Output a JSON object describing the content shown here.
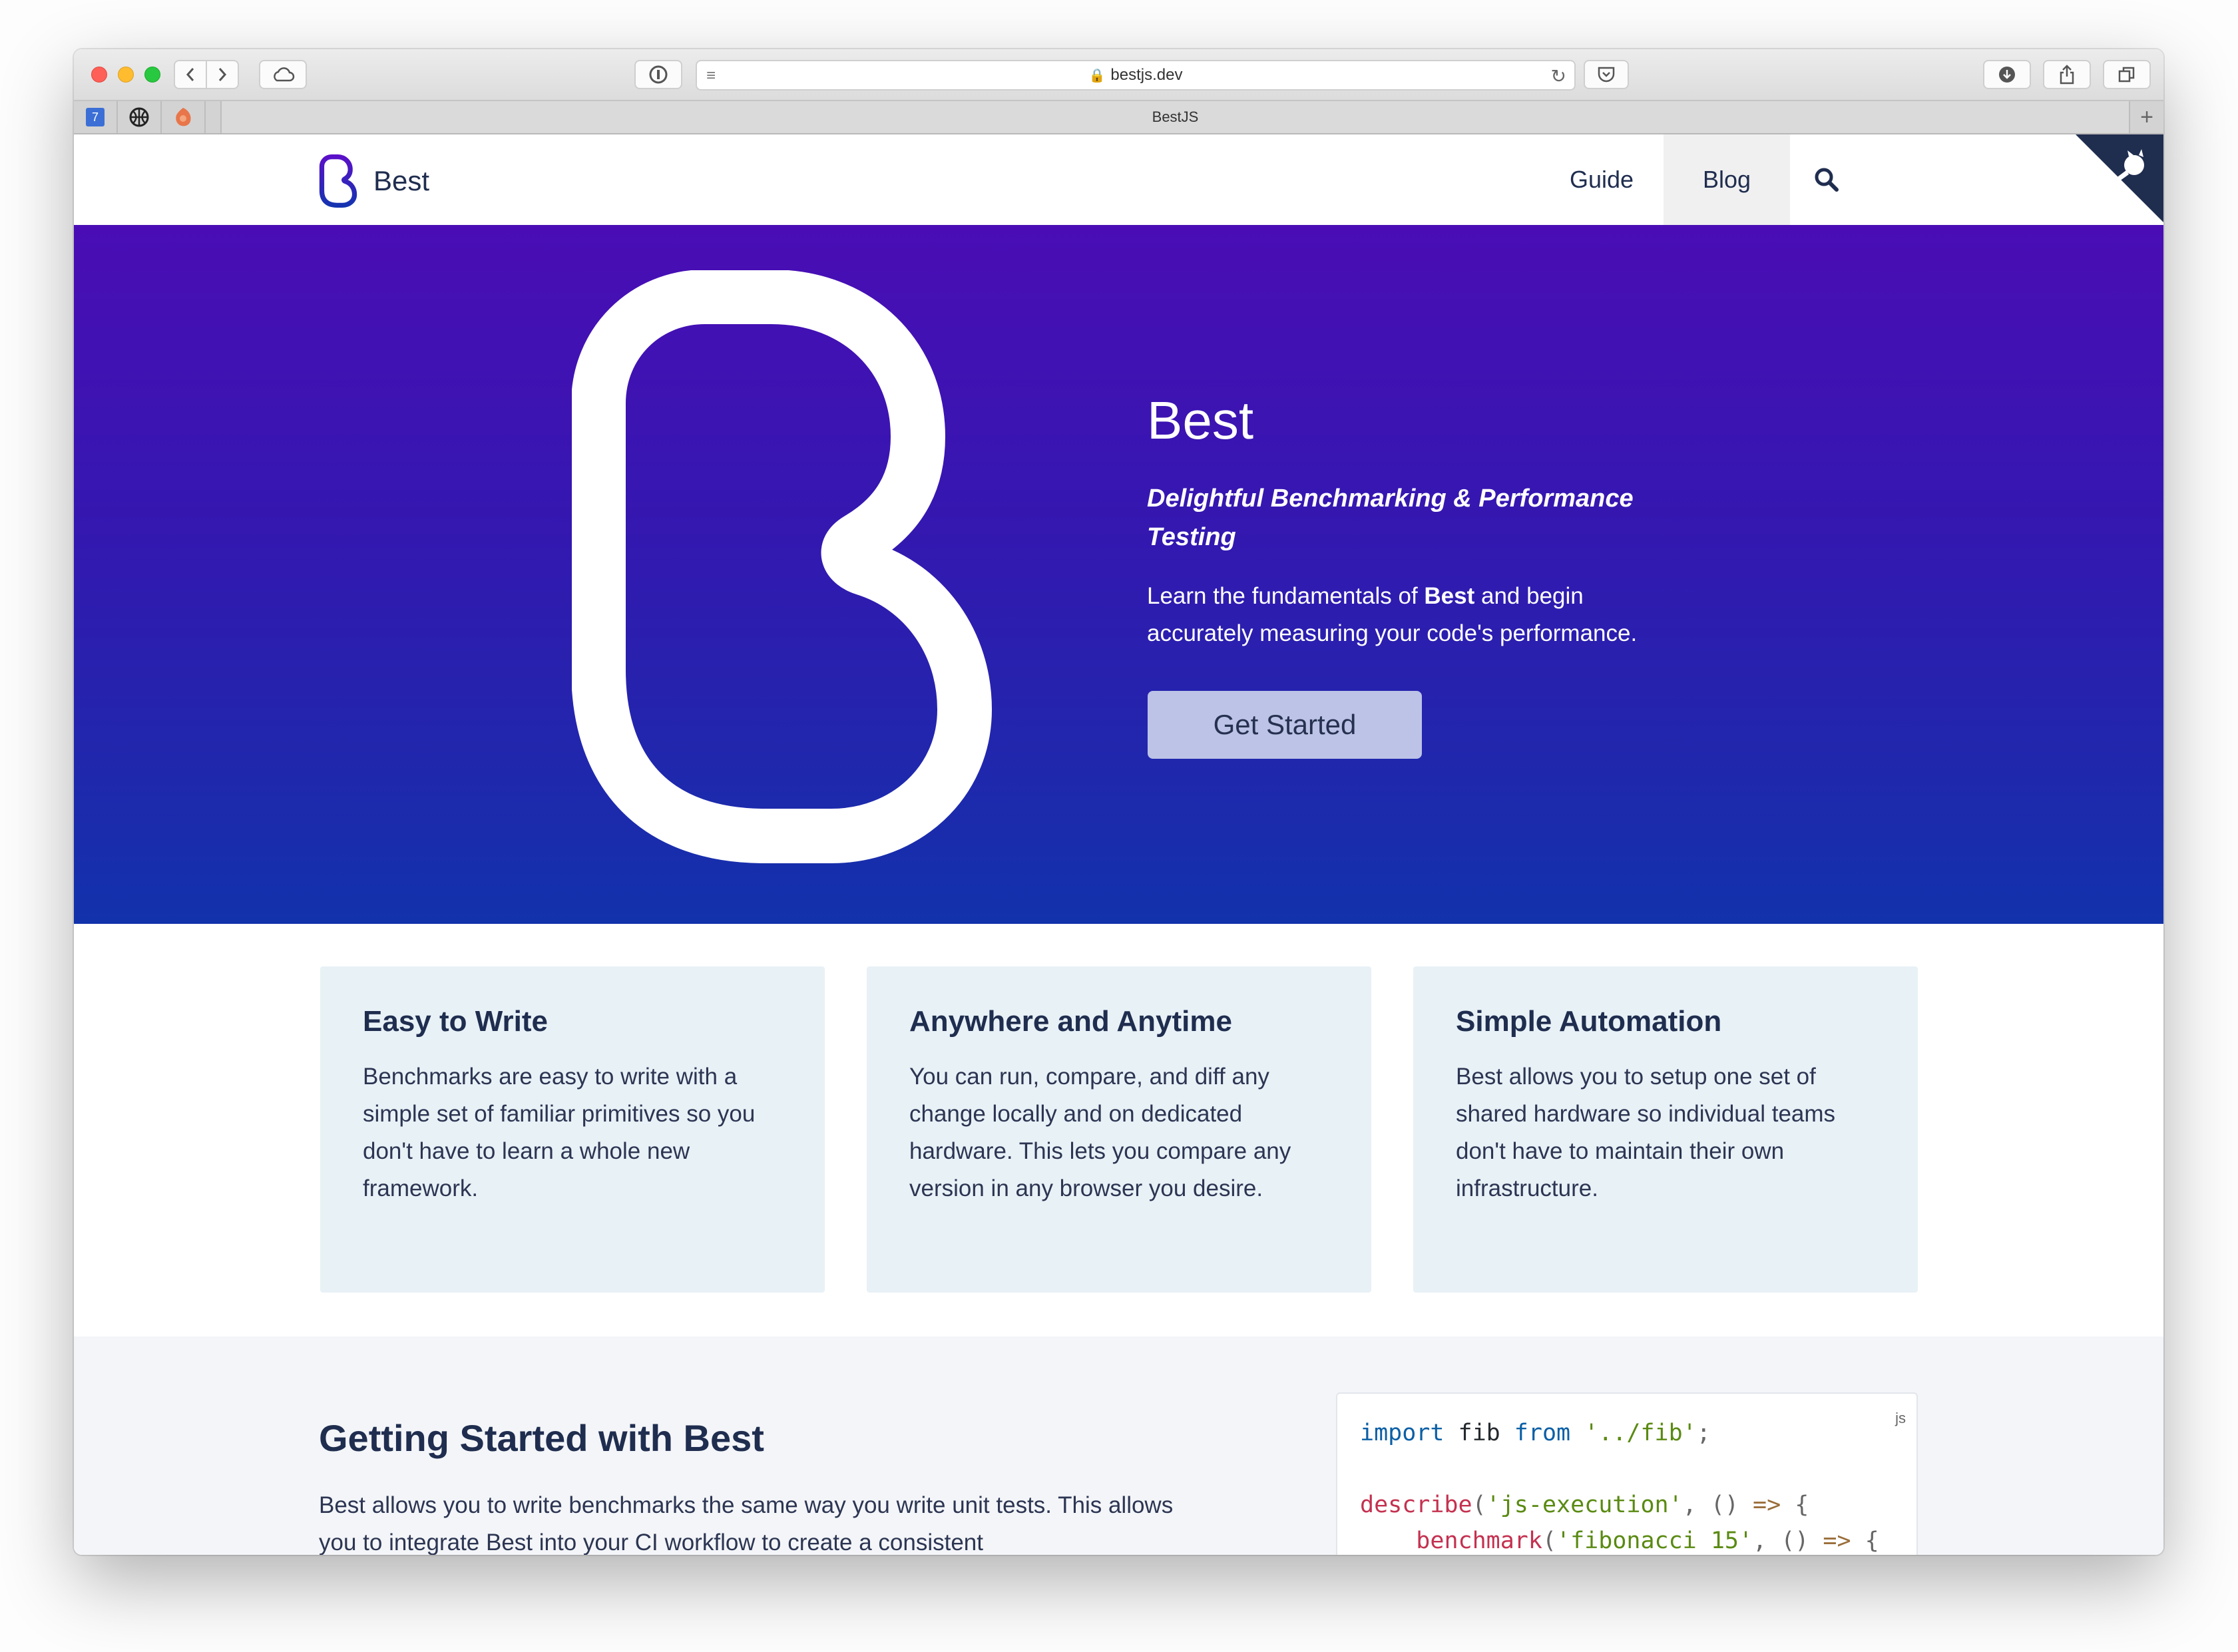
{
  "browser": {
    "url": "bestjs.dev",
    "tab_title": "BestJS",
    "pinned_tabs": [
      {
        "icon": "calendar-icon",
        "label": "7"
      },
      {
        "icon": "basketball-icon"
      },
      {
        "icon": "firefox-icon"
      }
    ],
    "new_tab_label": "+"
  },
  "header": {
    "brand": "Best",
    "nav": [
      {
        "label": "Guide"
      },
      {
        "label": "Blog"
      }
    ],
    "search_icon": "search-icon",
    "corner_icon": "github-octocat-icon"
  },
  "hero": {
    "title": "Best",
    "tagline": "Delightful Benchmarking & Performance Testing",
    "desc_prefix": "Learn the fundamentals of ",
    "desc_bold": "Best",
    "desc_suffix": " and begin accurately measuring your code's performance.",
    "cta": "Get Started"
  },
  "features": [
    {
      "title": "Easy to Write",
      "body": "Benchmarks are easy to write with a simple set of familiar primitives so you don't have to learn a whole new framework."
    },
    {
      "title": "Anywhere and Anytime",
      "body": "You can run, compare, and diff any change locally and on dedicated hardware. This lets you compare any version in any browser you desire."
    },
    {
      "title": "Simple Automation",
      "body": "Best allows you to setup one set of shared hardware so individual teams don't have to maintain their own infrastructure."
    }
  ],
  "getting_started": {
    "title": "Getting Started with Best",
    "body": "Best allows you to write benchmarks the same way you write unit tests. This allows you to integrate Best into your CI workflow to create a consistent"
  },
  "code": {
    "lang": "js",
    "line1": {
      "kw1": "import",
      "id": " fib ",
      "kw2": "from",
      "str": " '../fib'",
      "end": ";"
    },
    "line3": {
      "fn": "describe",
      "open": "(",
      "str": "'js-execution'",
      "comma": ", ",
      "parens": "()",
      "arrow": " =>",
      "brace": " {"
    },
    "line4": {
      "indent": "    ",
      "fn": "benchmark",
      "open": "(",
      "str": "'fibonacci 15'",
      "comma": ", ",
      "parens": "()",
      "arrow": " =>",
      "brace": " {"
    }
  },
  "colors": {
    "brand_purple": "#4a0db5",
    "brand_blue": "#1232ab",
    "navy_text": "#1f2d4f",
    "card_bg": "#e8f1f6",
    "cta_bg": "#bcc3e6"
  }
}
